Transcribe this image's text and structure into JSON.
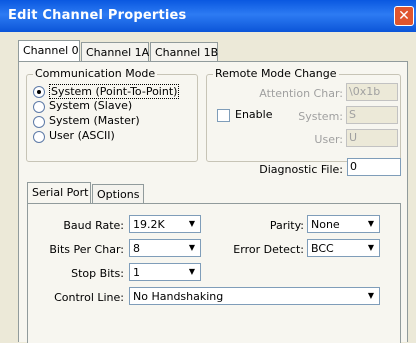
{
  "window": {
    "title": "Edit Channel Properties",
    "close_glyph": "✕"
  },
  "tabs": [
    {
      "label": "Channel 0",
      "active": true
    },
    {
      "label": "Channel 1A",
      "active": false
    },
    {
      "label": "Channel 1B",
      "active": false
    }
  ],
  "comm_mode": {
    "title": "Communication Mode",
    "options": [
      {
        "label": "System (Point-To-Point)",
        "selected": true
      },
      {
        "label": "System (Slave)",
        "selected": false
      },
      {
        "label": "System (Master)",
        "selected": false
      },
      {
        "label": "User (ASCII)",
        "selected": false
      }
    ]
  },
  "remote": {
    "title": "Remote Mode Change",
    "enable_label": "Enable",
    "enabled": false,
    "attention_label": "Attention Char:",
    "attention_value": "\\0x1b",
    "system_label": "System:",
    "system_value": "S",
    "user_label": "User:",
    "user_value": "U"
  },
  "diagnostic": {
    "label": "Diagnostic File:",
    "value": "0"
  },
  "subtabs": [
    {
      "label": "Serial Port",
      "active": true
    },
    {
      "label": "Options",
      "active": false
    }
  ],
  "serial": {
    "baud_label": "Baud Rate:",
    "baud_value": "19.2K",
    "parity_label": "Parity:",
    "parity_value": "None",
    "bits_label": "Bits Per Char:",
    "bits_value": "8",
    "error_label": "Error Detect:",
    "error_value": "BCC",
    "stop_label": "Stop Bits:",
    "stop_value": "1",
    "control_label": "Control Line:",
    "control_value": "No Handshaking"
  },
  "icons": {
    "dropdown_arrow": "▼"
  }
}
